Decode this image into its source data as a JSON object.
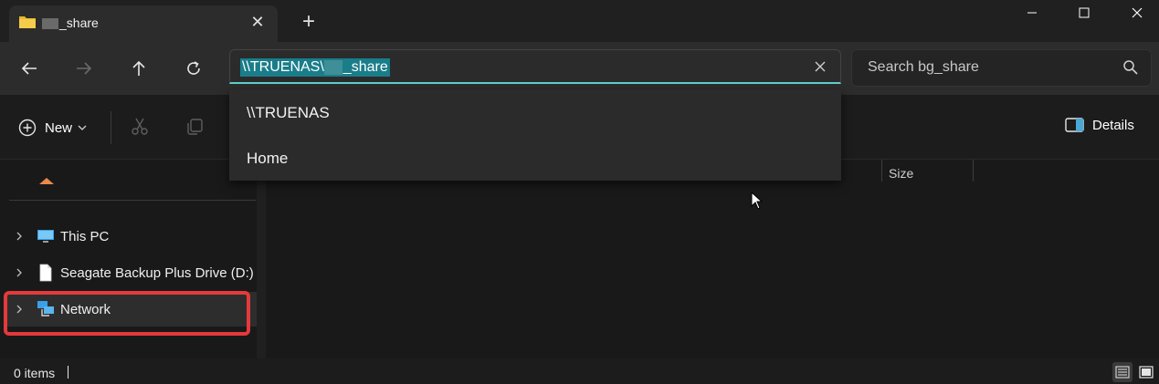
{
  "tab": {
    "title": "_share",
    "close": "✕"
  },
  "new_tab": "+",
  "address": {
    "path_prefix": "\\\\TRUENAS\\",
    "path_suffix": "_share"
  },
  "search": {
    "placeholder": "Search bg_share"
  },
  "toolbar": {
    "new_label": "New",
    "details_label": "Details"
  },
  "dropdown": {
    "items": [
      "\\\\TRUENAS",
      "Home"
    ]
  },
  "columns": {
    "size": "Size"
  },
  "sidebar": {
    "items": [
      {
        "label": "This PC"
      },
      {
        "label": "Seagate Backup Plus Drive (D:)"
      },
      {
        "label": "Network"
      }
    ]
  },
  "status": {
    "item_count": "0 items"
  },
  "colors": {
    "accent": "#60cdcd",
    "selection": "#1a7d8a",
    "highlight_box": "#e5393b"
  }
}
